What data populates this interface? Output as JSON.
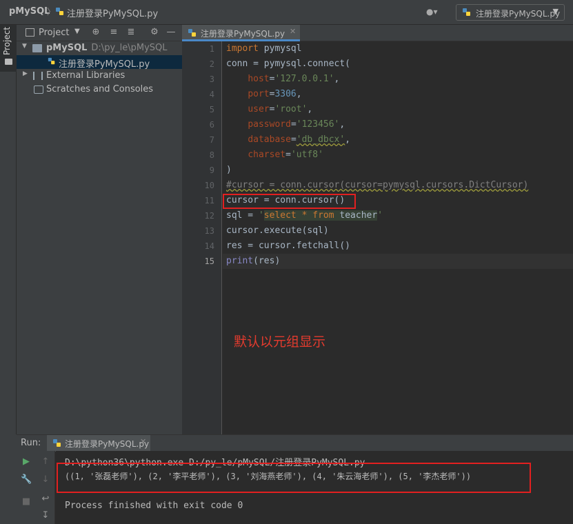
{
  "navbar": {
    "project_crumb": "pMySQL",
    "separator": "〉",
    "file_crumb": "注册登录PyMySQL.py",
    "run_config": "注册登录PyMySQL.py"
  },
  "toolstrip": {
    "project_tab": "Project"
  },
  "project_panel": {
    "header_label": "Project",
    "tree": [
      {
        "label": "pMySQL",
        "path": "D:\\py_le\\pMySQL"
      },
      {
        "label": "注册登录PyMySQL.py"
      },
      {
        "label": "External Libraries"
      },
      {
        "label": "Scratches and Consoles"
      }
    ]
  },
  "editor": {
    "tab_label": "注册登录PyMySQL.py",
    "line_numbers": [
      "1",
      "2",
      "3",
      "4",
      "5",
      "6",
      "7",
      "8",
      "9",
      "10",
      "11",
      "12",
      "13",
      "14",
      "15"
    ],
    "code": {
      "l1_kw": "import",
      "l1_rest": " pymysql",
      "l2": "conn = pymysql.connect(",
      "l3_param": "host",
      "l3_str": "'127.0.0.1'",
      "l4_param": "port",
      "l4_num": "3306",
      "l5_param": "user",
      "l5_str": "'root'",
      "l6_param": "password",
      "l6_str": "'123456'",
      "l7_param": "database",
      "l7_str": "'db_dbcx'",
      "l8_param": "charset",
      "l8_str": "'utf8'",
      "l9": ")",
      "l10": "#cursor = conn.cursor(cursor=pymysql.cursors.DictCursor)",
      "l11": "cursor = conn.cursor()",
      "l12_pre": "sql = ",
      "l12_q1": "'",
      "l12_select": "select",
      "l12_star": " * ",
      "l12_from": "from",
      "l12_table": " teacher",
      "l12_q2": "'",
      "l13": "cursor.execute(sql)",
      "l14": "res = cursor.fetchall()",
      "l15_fn": "print",
      "l15_rest": "(res)"
    },
    "annotation": "默认以元组显示"
  },
  "run": {
    "label": "Run:",
    "tab_label": "注册登录PyMySQL.py",
    "output": {
      "command": "D:\\python36\\python.exe D:/py_le/pMySQL/注册登录PyMySQL.py",
      "result": "((1, '张磊老师'), (2, '李平老师'), (3, '刘海燕老师'), (4, '朱云海老师'), (5, '李杰老师'))",
      "finished": "Process finished with exit code 0"
    }
  },
  "colors": {
    "keyword": "#cc7832",
    "string": "#6a8759",
    "number": "#6897bb",
    "param": "#aa4926",
    "comment": "#808080",
    "highlight_box": "#e32020"
  },
  "icons": [
    "python-file-icon",
    "user-icon",
    "folder-icon",
    "library-icon",
    "scratch-icon",
    "run-icon",
    "wrench-icon",
    "stop-icon",
    "arrow-up-icon",
    "arrow-down-icon",
    "soft-wrap-icon",
    "scroll-end-icon",
    "gear-icon",
    "target-icon",
    "collapse-icon",
    "expand-icon"
  ]
}
